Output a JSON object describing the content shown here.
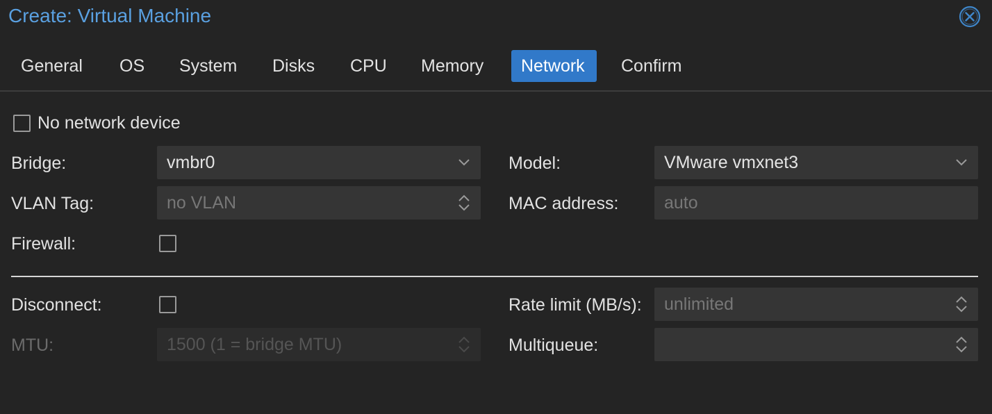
{
  "window": {
    "title": "Create: Virtual Machine",
    "close_icon": "close-circle-icon"
  },
  "tabs": [
    {
      "label": "General",
      "active": false
    },
    {
      "label": "OS",
      "active": false
    },
    {
      "label": "System",
      "active": false
    },
    {
      "label": "Disks",
      "active": false
    },
    {
      "label": "CPU",
      "active": false
    },
    {
      "label": "Memory",
      "active": false
    },
    {
      "label": "Network",
      "active": true
    },
    {
      "label": "Confirm",
      "active": false
    }
  ],
  "form": {
    "no_network": {
      "label": "No network device",
      "checked": false
    },
    "bridge": {
      "label": "Bridge:",
      "value": "vmbr0"
    },
    "model": {
      "label": "Model:",
      "value": "VMware vmxnet3"
    },
    "vlan": {
      "label": "VLAN Tag:",
      "placeholder": "no VLAN"
    },
    "mac": {
      "label": "MAC address:",
      "placeholder": "auto"
    },
    "firewall": {
      "label": "Firewall:",
      "checked": false
    },
    "disconnect": {
      "label": "Disconnect:",
      "checked": false
    },
    "rate_limit": {
      "label": "Rate limit (MB/s):",
      "placeholder": "unlimited"
    },
    "mtu": {
      "label": "MTU:",
      "placeholder": "1500 (1 = bridge MTU)",
      "disabled": true
    },
    "multiqueue": {
      "label": "Multiqueue:",
      "value": ""
    }
  },
  "colors": {
    "background": "#242424",
    "accent": "#3179c9",
    "title": "#5aa0e0",
    "field": "#353535"
  }
}
